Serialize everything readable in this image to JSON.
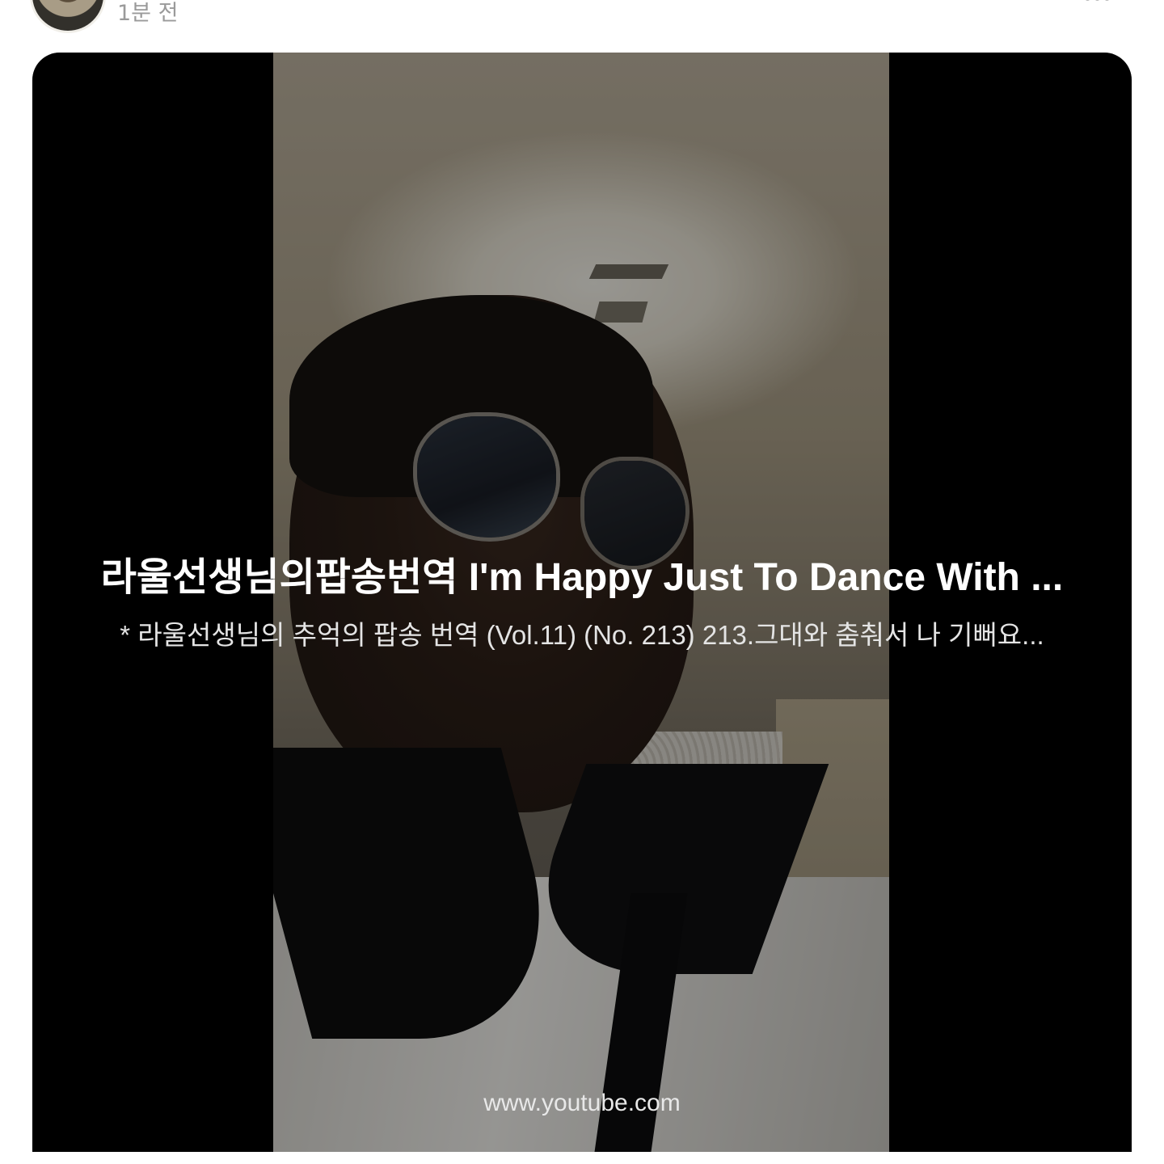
{
  "post": {
    "timestamp": "1분 전"
  },
  "link_card": {
    "title": "라울선생님의팝송번역 I'm Happy Just To Dance With ...",
    "description": "* 라울선생님의 추억의 팝송 번역 (Vol.11) (No. 213)  213.그대와 춤춰서 나 기뻐요...",
    "source": "www.youtube.com"
  },
  "icons": {
    "more": "more-horizontal-icon"
  }
}
